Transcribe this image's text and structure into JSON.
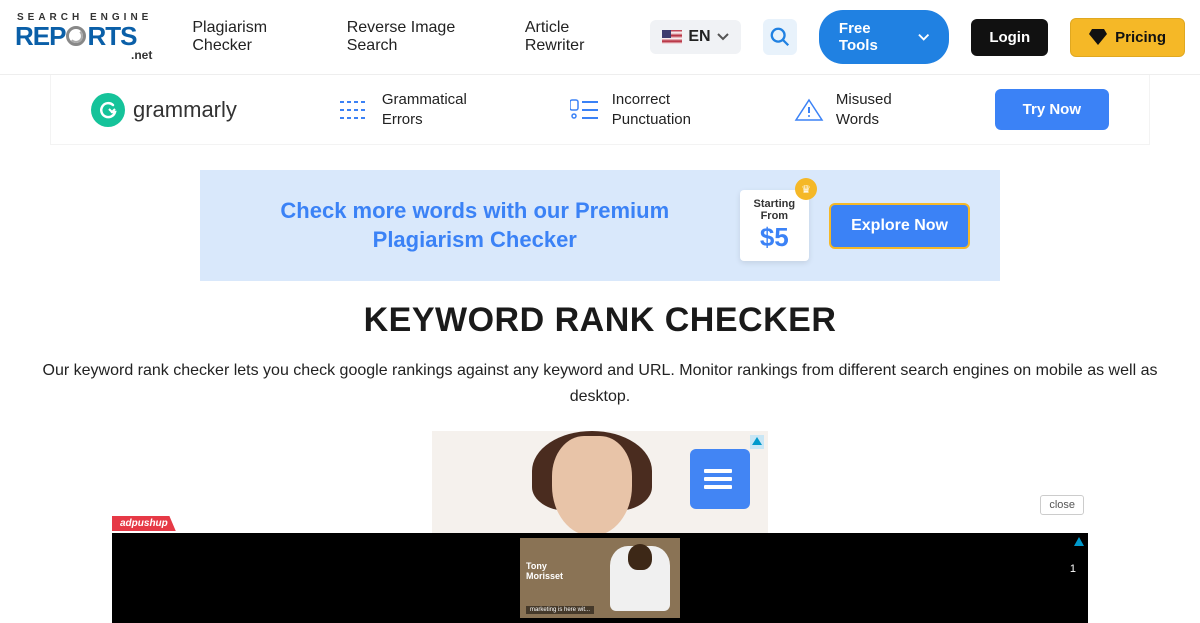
{
  "logo": {
    "top": "SEARCH    ENGINE",
    "mid_pre": "REP",
    "mid_post": "RTS",
    "bot": ".net"
  },
  "nav": {
    "plagiarism": "Plagiarism Checker",
    "reverse": "Reverse Image Search",
    "rewriter": "Article Rewriter"
  },
  "lang": "EN",
  "free_tools": "Free Tools",
  "login": "Login",
  "pricing": "Pricing",
  "grammarly": {
    "brand": "grammarly",
    "item1a": "Grammatical",
    "item1b": "Errors",
    "item2a": "Incorrect",
    "item2b": "Punctuation",
    "item3a": "Misused",
    "item3b": "Words",
    "cta": "Try Now"
  },
  "promo": {
    "line1": "Check more words with our Premium",
    "line2": "Plagiarism Checker",
    "starting": "Starting",
    "from": "From",
    "price": "$5",
    "cta": "Explore Now"
  },
  "title": "KEYWORD RANK CHECKER",
  "description": "Our keyword rank checker lets you check google rankings against any keyword and URL. Monitor rankings from different search engines on mobile as well as desktop.",
  "close": "close",
  "adpushup": "adpushup",
  "bottom_ad": {
    "name1": "Tony",
    "name2": "Morisset",
    "num": "1"
  }
}
